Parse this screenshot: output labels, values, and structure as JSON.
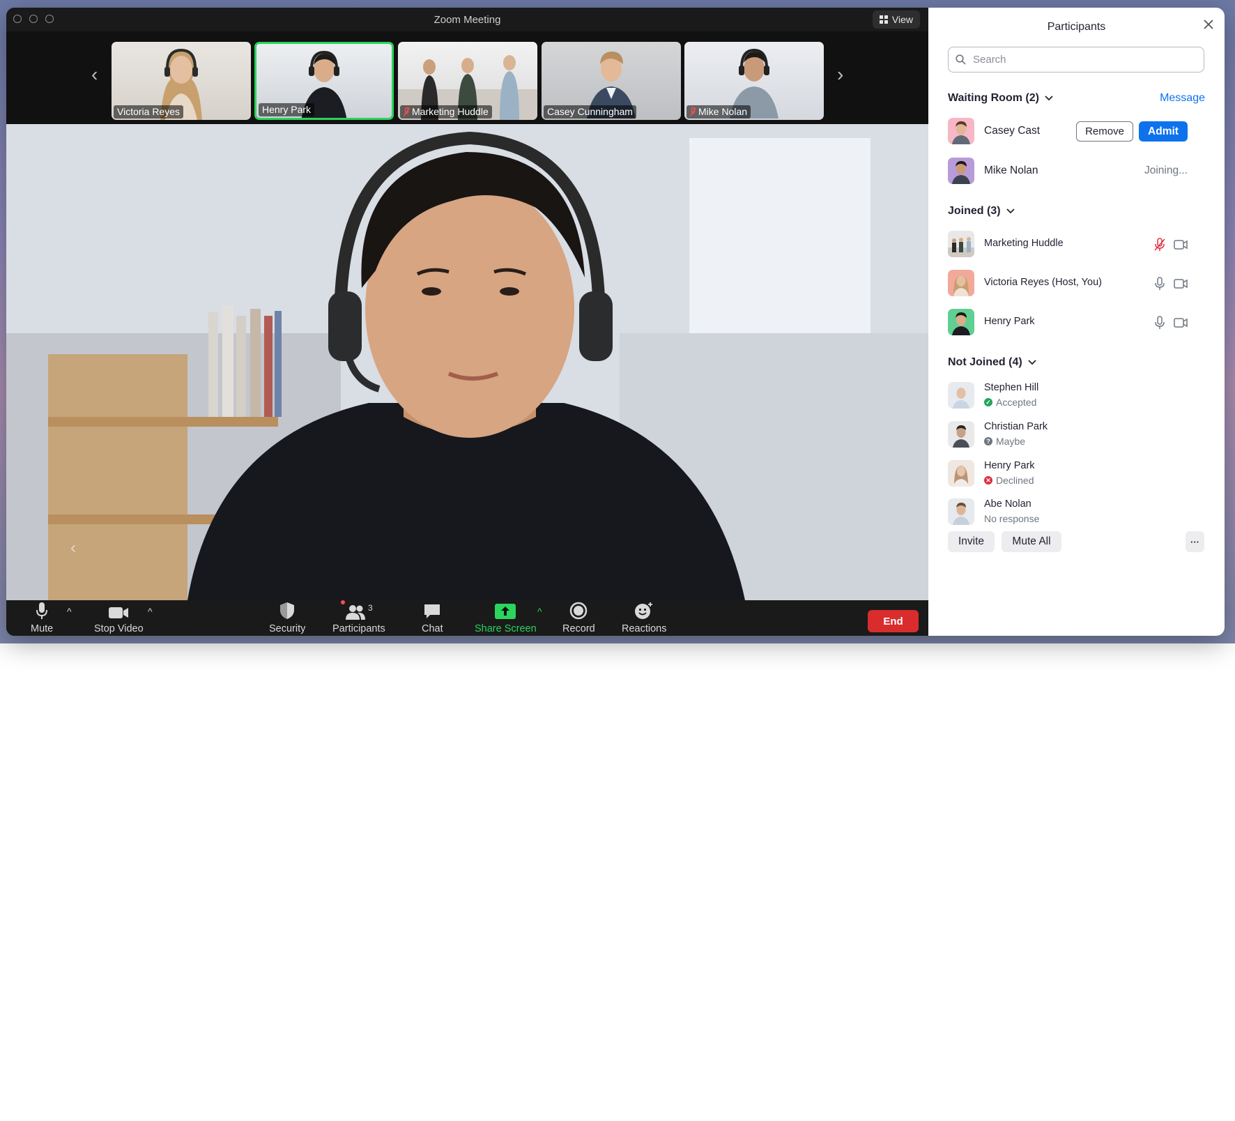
{
  "window": {
    "title": "Zoom Meeting",
    "view_label": "View"
  },
  "strip": {
    "thumbnails": [
      {
        "name": "Victoria Reyes",
        "muted": false
      },
      {
        "name": "Henry Park",
        "muted": false,
        "active": true
      },
      {
        "name": "Marketing Huddle",
        "muted": true
      },
      {
        "name": "Casey Cunningham",
        "muted": false
      },
      {
        "name": "Mike Nolan",
        "muted": true
      }
    ]
  },
  "toolbar": {
    "mute": "Mute",
    "stop_video": "Stop Video",
    "security": "Security",
    "participants": "Participants",
    "participants_count": "3",
    "chat": "Chat",
    "share_screen": "Share Screen",
    "record": "Record",
    "reactions": "Reactions",
    "end": "End",
    "accent_green": "#2bd45d",
    "end_color": "#d92d2d"
  },
  "panel": {
    "title": "Participants",
    "search_placeholder": "Search",
    "waiting_room": {
      "header": "Waiting Room (2)",
      "message_link": "Message",
      "people": [
        {
          "name": "Casey Cast",
          "remove_label": "Remove",
          "admit_label": "Admit"
        },
        {
          "name": "Mike Nolan",
          "status": "Joining..."
        }
      ]
    },
    "joined": {
      "header": "Joined (3)",
      "people": [
        {
          "name": "Marketing Huddle",
          "mic": "muted",
          "video": "on"
        },
        {
          "name": "Victoria Reyes (Host, You)",
          "mic": "on",
          "video": "on"
        },
        {
          "name": "Henry Park",
          "mic": "on",
          "video": "on"
        }
      ]
    },
    "not_joined": {
      "header": "Not Joined (4)",
      "people": [
        {
          "name": "Stephen Hill",
          "status": "Accepted",
          "status_icon": "check-circle-icon",
          "status_color": "#23a55a"
        },
        {
          "name": "Christian Park",
          "status": "Maybe",
          "status_icon": "question-circle-icon",
          "status_color": "#6e7680"
        },
        {
          "name": "Henry Park",
          "status": "Declined",
          "status_icon": "x-circle-icon",
          "status_color": "#e02d3c"
        },
        {
          "name": "Abe Nolan",
          "status": "No response"
        }
      ]
    },
    "footer": {
      "invite": "Invite",
      "mute_all": "Mute All",
      "more": "···"
    },
    "accent_blue": "#0e72ed"
  }
}
